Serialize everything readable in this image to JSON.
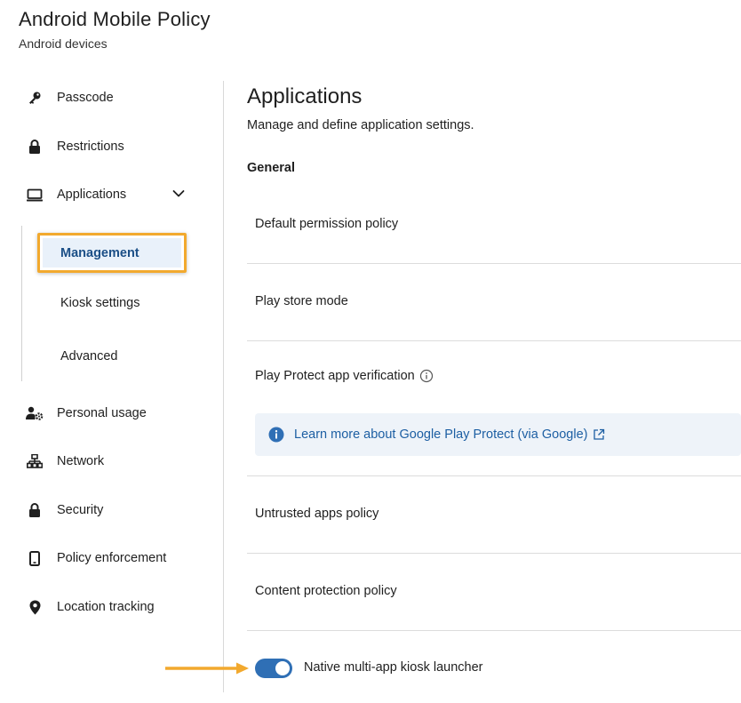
{
  "header": {
    "title": "Android Mobile Policy",
    "subtitle": "Android devices"
  },
  "sidebar": {
    "items": [
      {
        "label": "Passcode",
        "icon": "key-icon"
      },
      {
        "label": "Restrictions",
        "icon": "lock-icon"
      },
      {
        "label": "Applications",
        "icon": "monitor-icon"
      },
      {
        "label": "Personal usage",
        "icon": "user-gear-icon"
      },
      {
        "label": "Network",
        "icon": "network-icon"
      },
      {
        "label": "Security",
        "icon": "lock-icon"
      },
      {
        "label": "Policy enforcement",
        "icon": "phone-icon"
      },
      {
        "label": "Location tracking",
        "icon": "location-pin-icon"
      }
    ],
    "subitems": [
      {
        "label": "Management",
        "selected": true
      },
      {
        "label": "Kiosk settings"
      },
      {
        "label": "Advanced"
      }
    ]
  },
  "main": {
    "title": "Applications",
    "description": "Manage and define application settings.",
    "general_label": "General",
    "rows": [
      {
        "label": "Default permission policy"
      },
      {
        "label": "Play store mode"
      },
      {
        "label": "Play Protect app verification"
      },
      {
        "label": "Untrusted apps policy"
      },
      {
        "label": "Content protection policy"
      }
    ],
    "info_link": "Learn more about Google Play Protect (via Google)",
    "toggle_label": "Native multi-app kiosk launcher",
    "toggle_on": true
  },
  "colors": {
    "accent": "#2f6fb5",
    "highlight": "#f2a92e",
    "selected_bg": "#e9f1fa",
    "link": "#1d5fa3"
  }
}
